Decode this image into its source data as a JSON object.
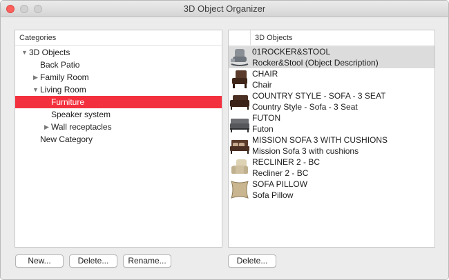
{
  "window": {
    "title": "3D Object Organizer"
  },
  "categories": {
    "header": "Categories",
    "items": [
      {
        "label": "3D Objects",
        "expanded": true
      },
      {
        "label": "Back Patio"
      },
      {
        "label": "Family Room",
        "expanded": false
      },
      {
        "label": "Living Room",
        "expanded": true
      },
      {
        "label": "Furniture",
        "selected": true
      },
      {
        "label": "Speaker system"
      },
      {
        "label": "Wall receptacles",
        "expanded": false
      },
      {
        "label": "New Category"
      }
    ]
  },
  "objects": {
    "header": "3D Objects",
    "items": [
      {
        "name": "01ROCKER&STOOL",
        "description": "Rocker&Stool (Object Description)",
        "selected": true,
        "icon": "rocker-icon"
      },
      {
        "name": "CHAIR",
        "description": "Chair",
        "icon": "chair-icon"
      },
      {
        "name": "COUNTRY STYLE - SOFA - 3 SEAT",
        "description": "Country Style - Sofa - 3 Seat",
        "icon": "sofa-icon"
      },
      {
        "name": "FUTON",
        "description": "Futon",
        "icon": "futon-icon"
      },
      {
        "name": "MISSION SOFA 3 WITH CUSHIONS",
        "description": "Mission Sofa 3 with cushions",
        "icon": "mission-sofa-icon"
      },
      {
        "name": "RECLINER 2 - BC",
        "description": "Recliner 2 - BC",
        "icon": "recliner-icon"
      },
      {
        "name": "SOFA PILLOW",
        "description": "Sofa Pillow",
        "icon": "pillow-icon"
      }
    ]
  },
  "buttons": {
    "new": "New...",
    "delete_category": "Delete...",
    "rename": "Rename...",
    "delete_object": "Delete..."
  },
  "colors": {
    "selection": "#f3313e",
    "object_selection": "#dcdcdc"
  }
}
